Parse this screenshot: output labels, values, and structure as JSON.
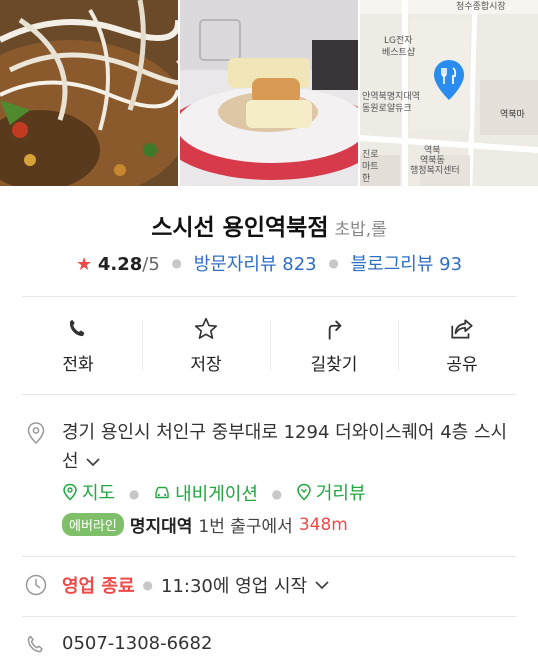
{
  "photos": [
    {
      "name": "dish-photo-1"
    },
    {
      "name": "dish-photo-2"
    },
    {
      "name": "map-thumbnail"
    }
  ],
  "map": {
    "labels": {
      "top": "청수종합시장",
      "lg_line1": "LG전자",
      "lg_line2": "베스트샵",
      "center_line1": "안역북명지대역",
      "center_line2": "동원로얄듀크",
      "station_east": "역북마",
      "myeongji_line1": "역북",
      "myeongji_line2": "역북동",
      "myeongji_line3": "행정복지센터",
      "left_line1": "진로",
      "left_line2": "마트",
      "left_line3": "한"
    },
    "pin_color": "#2b8cf0"
  },
  "place": {
    "name": "스시선 용인역북점",
    "category": "초밥,롤",
    "rating_star": "★",
    "rating": "4.28",
    "rating_max": "/5",
    "visitor_reviews_label": "방문자리뷰",
    "visitor_reviews_count": "823",
    "blog_reviews_label": "블로그리뷰",
    "blog_reviews_count": "93"
  },
  "actions": [
    {
      "label": "전화",
      "icon": "phone-icon"
    },
    {
      "label": "저장",
      "icon": "star-outline-icon"
    },
    {
      "label": "길찾기",
      "icon": "directions-icon"
    },
    {
      "label": "공유",
      "icon": "share-icon"
    }
  ],
  "address": {
    "line": "경기 용인시 처인구 중부대로 1294 더와이스퀘어 4층 스시선",
    "links": [
      {
        "label": "지도",
        "icon": "map-pin-icon"
      },
      {
        "label": "내비게이션",
        "icon": "car-icon"
      },
      {
        "label": "거리뷰",
        "icon": "street-view-icon"
      }
    ],
    "subway_line": "에버라인",
    "station": "명지대역",
    "exit_text": "1번 출구에서",
    "distance": "348m"
  },
  "hours": {
    "status": "영업 종료",
    "next": "11:30에 영업 시작"
  },
  "phone": "0507-1308-6682",
  "colors": {
    "accent_blue": "#2e6fc6",
    "accent_green": "#22a840",
    "accent_red": "#ef4a4a",
    "everline_green": "#7fbf6a"
  }
}
